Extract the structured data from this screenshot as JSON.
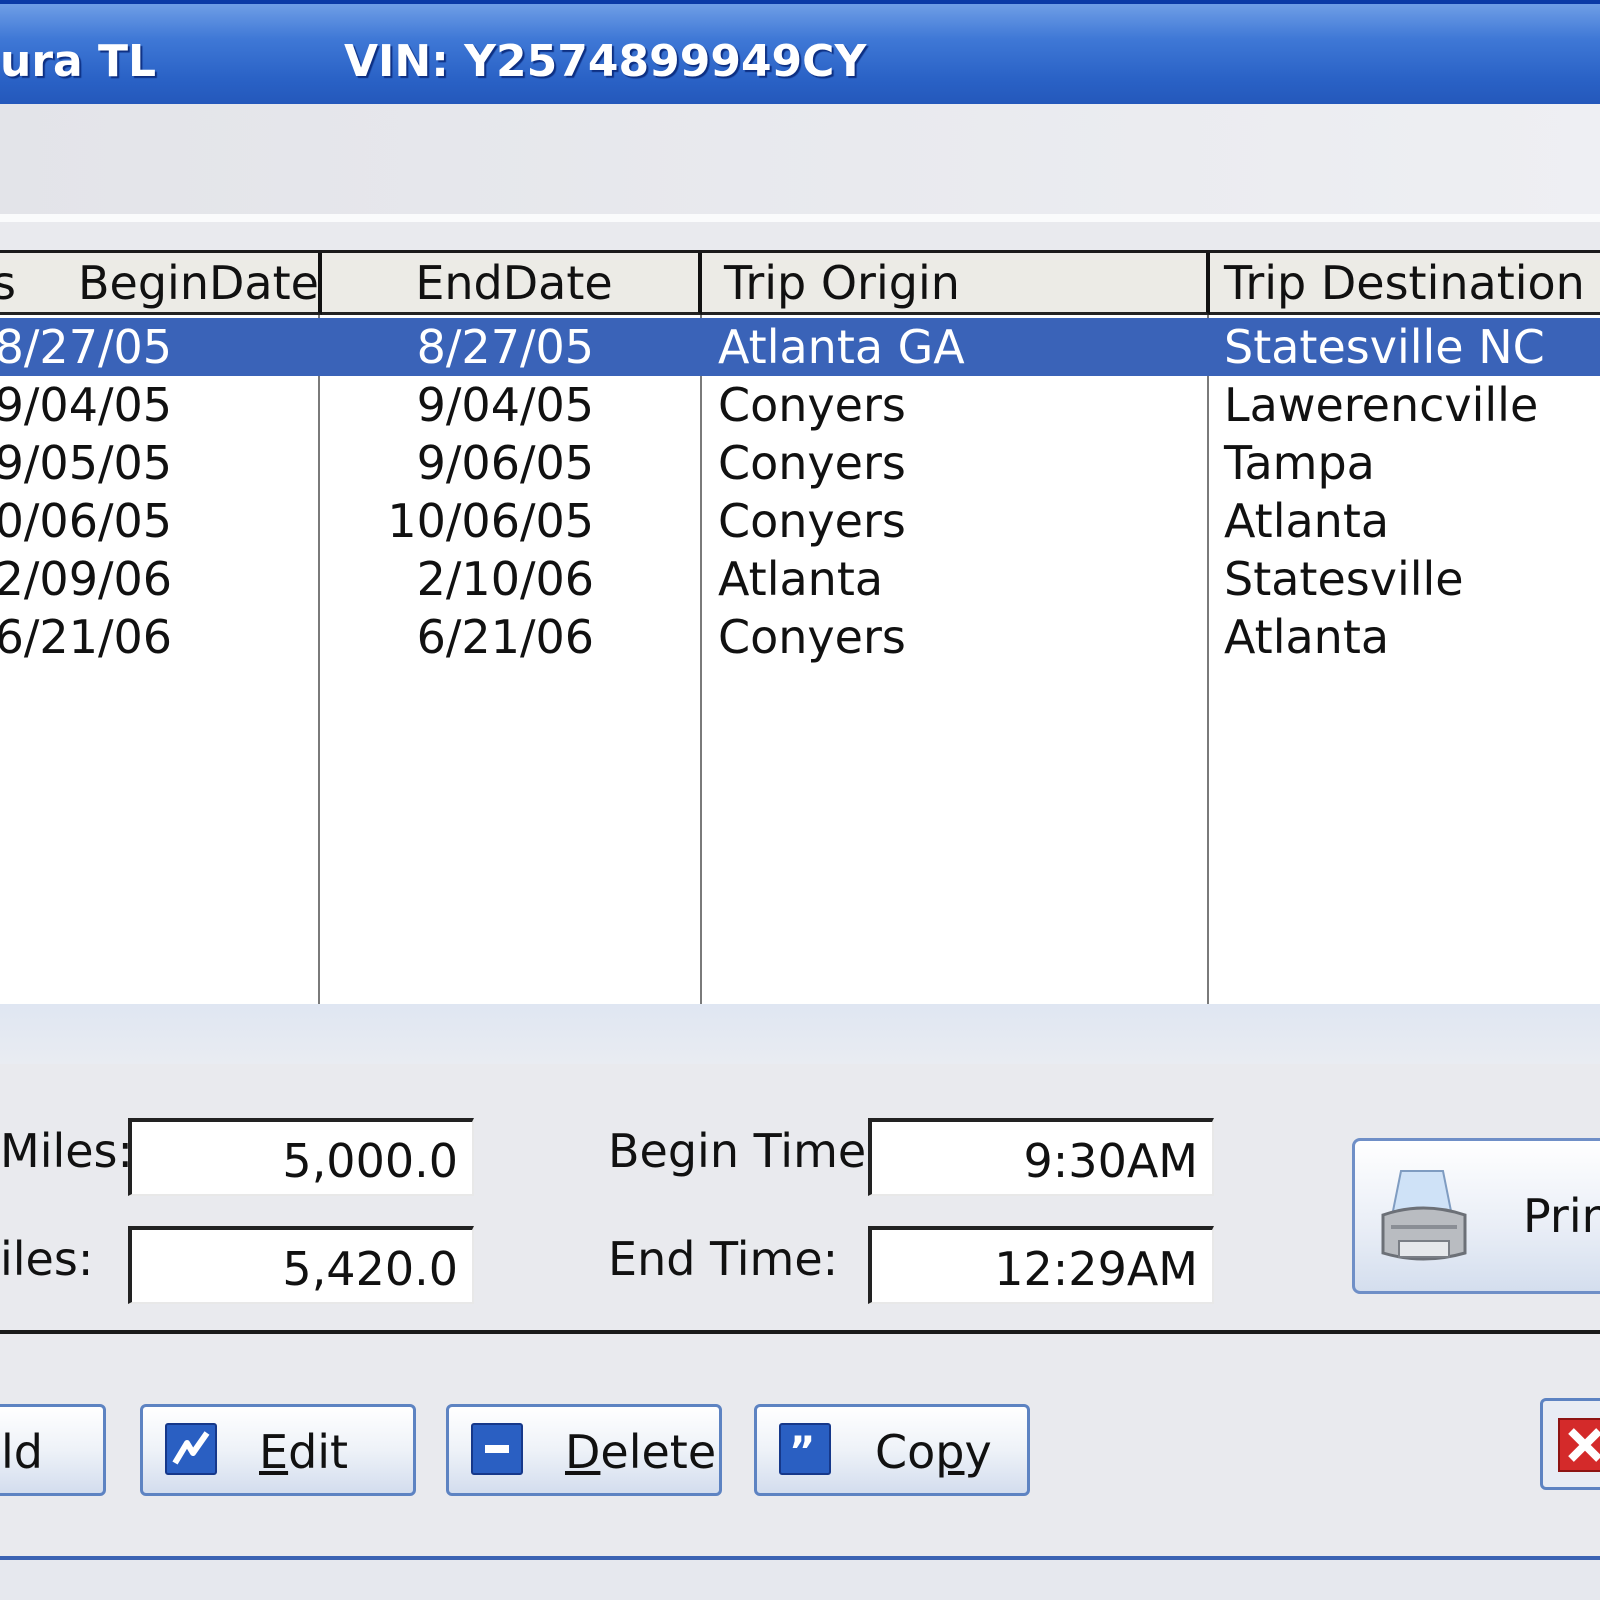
{
  "window": {
    "title_model": "ura TL",
    "title_vin": "VIN: Y2574899949CY"
  },
  "table": {
    "headers": {
      "prev": "s",
      "begin_date": "BeginDate",
      "end_date": "EndDate",
      "trip_origin": "Trip Origin",
      "trip_destination": "Trip Destination"
    },
    "rows": [
      {
        "begin": "8/27/05",
        "end": "8/27/05",
        "origin": "Atlanta GA",
        "destination": "Statesville NC"
      },
      {
        "begin": "9/04/05",
        "end": "9/04/05",
        "origin": "Conyers",
        "destination": "Lawerencville"
      },
      {
        "begin": "9/05/05",
        "end": "9/06/05",
        "origin": "Conyers",
        "destination": "Tampa"
      },
      {
        "begin": "10/06/05",
        "end": "10/06/05",
        "origin": "Conyers",
        "destination": "Atlanta"
      },
      {
        "begin": "2/09/06",
        "end": "2/10/06",
        "origin": "Atlanta",
        "destination": "Statesville"
      },
      {
        "begin": "6/21/06",
        "end": "6/21/06",
        "origin": "Conyers",
        "destination": "Atlanta"
      }
    ]
  },
  "details": {
    "begin_miles_label": "Miles:",
    "begin_miles": "5,000.0",
    "end_miles_label": "iles:",
    "end_miles": "5,420.0",
    "begin_time_label": "Begin Time:",
    "begin_time": "9:30AM",
    "end_time_label": "End Time:",
    "end_time": "12:29AM",
    "print_label": "Prin"
  },
  "buttons": {
    "add": "ld",
    "edit_first": "E",
    "edit_rest": "dit",
    "delete_first": "D",
    "delete_rest": "elete",
    "copy_start": "Co",
    "copy_u": "p",
    "copy_end": "y"
  },
  "icons": {
    "edit": "edit-icon",
    "delete": "delete-icon",
    "copy": "copy-icon",
    "printer": "printer-icon",
    "close": "close-icon"
  },
  "colors": {
    "title_blue": "#2a62c6",
    "selection": "#3a63b8",
    "close_red": "#d42a2a"
  }
}
